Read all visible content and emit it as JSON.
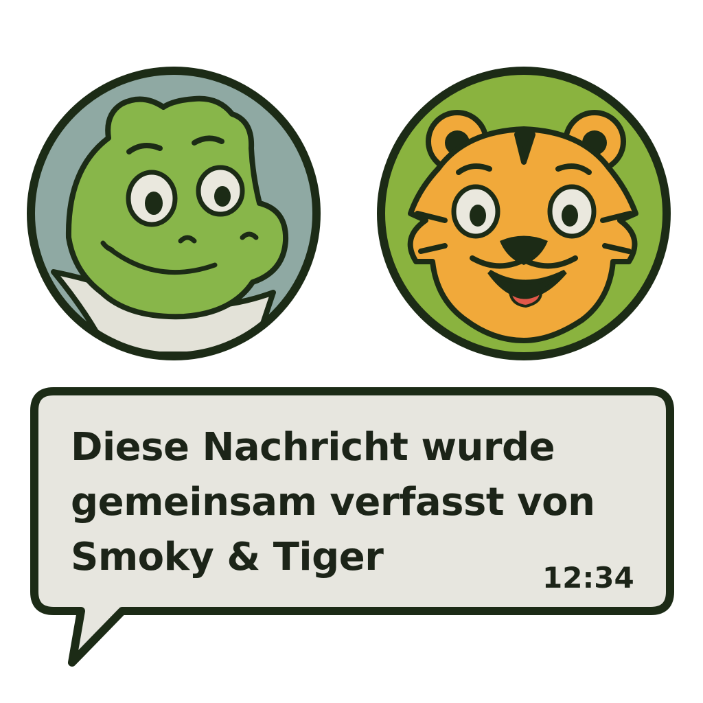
{
  "participants": [
    {
      "name": "Smoky",
      "icon": "crocodile-face-icon",
      "background": "#8fa9a3",
      "skin": "#88b64a"
    },
    {
      "name": "Tiger",
      "icon": "tiger-face-icon",
      "background": "#8ab33f",
      "fur": "#f1a93a"
    }
  ],
  "message": {
    "lines": [
      "Diese Nachricht wurde",
      "gemeinsam verfasst von",
      "Smoky & Tiger"
    ],
    "time": "12:34"
  },
  "colors": {
    "outline": "#1c2b16",
    "bubble_fill": "#e7e6df",
    "text": "#1c2418"
  }
}
